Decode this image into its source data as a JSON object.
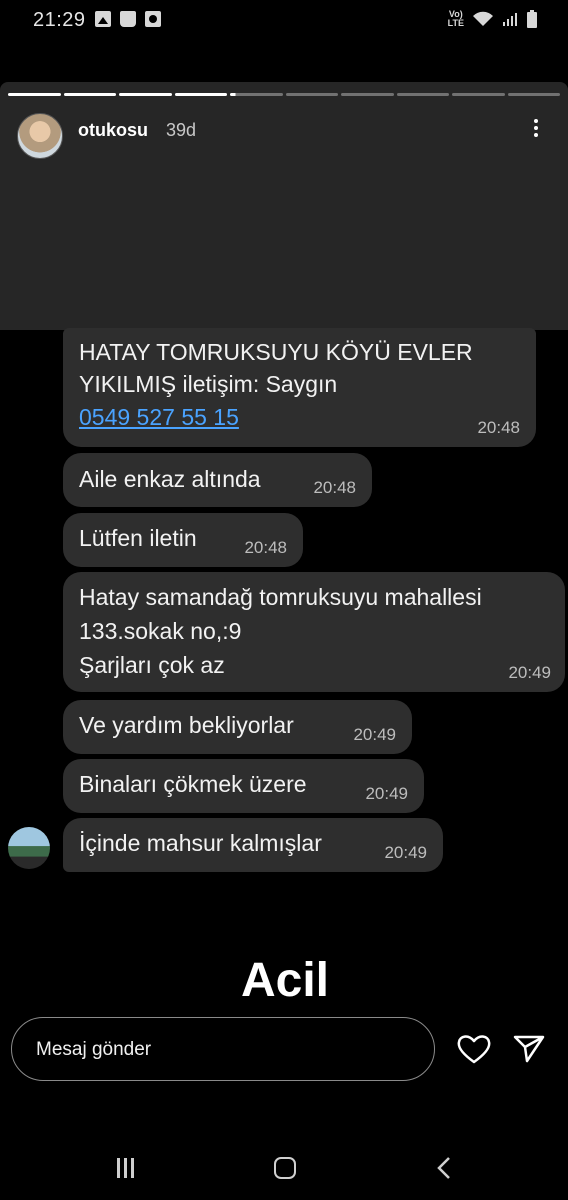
{
  "status_bar": {
    "time": "21:29",
    "network": "Vo) LTE"
  },
  "story": {
    "username": "otukosu",
    "age": "39d",
    "progress_segments": {
      "total": 10,
      "completed": 4,
      "current_fraction": 0.1
    }
  },
  "messages": [
    {
      "lines": [
        "HATAY TOMRUKSUYU KÖYÜ EVLER",
        "YIKILMIŞ iletişim: Saygın"
      ],
      "link": "0549 527 55 15",
      "time": "20:48"
    },
    {
      "text": "Aile enkaz altında",
      "time": "20:48"
    },
    {
      "text": "Lütfen iletin",
      "time": "20:48"
    },
    {
      "lines": [
        "Hatay samandağ tomruksuyu mahallesi",
        "133.sokak no,:9",
        "Şarjları çok az"
      ],
      "time": "20:49"
    },
    {
      "text": "Ve yardım bekliyorlar",
      "time": "20:49"
    },
    {
      "text": "Binaları çökmek üzere",
      "time": "20:49"
    },
    {
      "text": "İçinde mahsur kalmışlar",
      "time": "20:49"
    }
  ],
  "sticker_text": "Acil",
  "reply": {
    "placeholder": "Mesaj gönder"
  },
  "icons": {
    "like": "heart-icon",
    "send": "send-icon",
    "more": "more-vertical-icon"
  },
  "colors": {
    "link": "#4aa3ff",
    "bubble": "#2e2e2e",
    "header_bg": "#262626"
  }
}
